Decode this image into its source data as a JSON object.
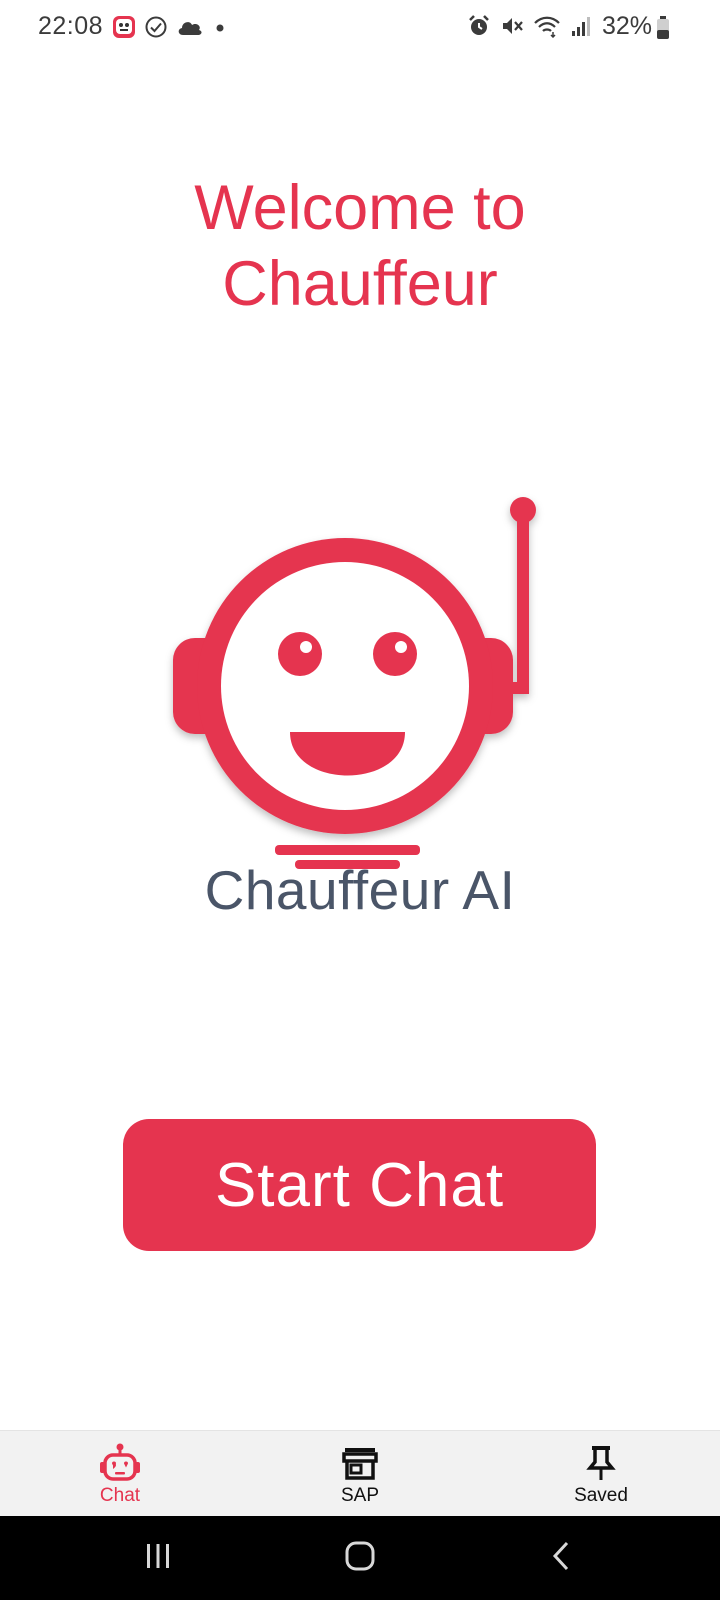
{
  "status_bar": {
    "time": "22:08",
    "battery_percent": "32%",
    "left_icons": [
      "app-notification-icon",
      "check-circle-icon",
      "cloud-icon",
      "dot-icon"
    ],
    "right_icons": [
      "alarm-icon",
      "mute-icon",
      "wifi-icon",
      "signal-icon",
      "battery-icon"
    ]
  },
  "main": {
    "title_line1": "Welcome to",
    "title_line2": "Chauffeur",
    "brand_name": "Chauffeur AI",
    "start_button_label": "Start Chat"
  },
  "bottom_nav": {
    "items": [
      {
        "label": "Chat",
        "icon": "robot-icon",
        "active": true
      },
      {
        "label": "SAP",
        "icon": "storefront-icon",
        "active": false
      },
      {
        "label": "Saved",
        "icon": "pin-icon",
        "active": false
      }
    ]
  },
  "colors": {
    "accent": "#e5344f",
    "brand_text": "#4a5568",
    "nav_background": "#f2f2f2",
    "system_nav": "#000000"
  }
}
